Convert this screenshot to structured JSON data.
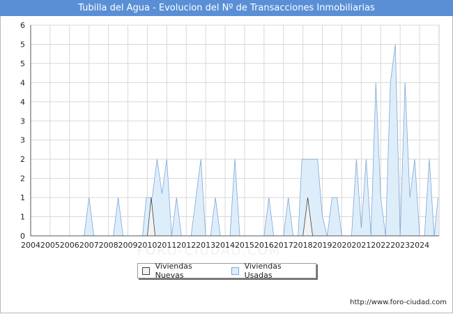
{
  "title": "Tubilla del Agua - Evolucion del Nº de Transacciones Inmobiliarias",
  "source": "http://www.foro-ciudad.com",
  "watermark": "FORO-CIUDAD.COM",
  "legend": {
    "nuevas": "Viviendas Nuevas",
    "usadas": "Viviendas Usadas"
  },
  "colors": {
    "title_bg": "#5a8fd6",
    "usadas_fill": "#ddeefa",
    "usadas_line": "#7fa6d8",
    "nuevas_fill": "#f2f2f2",
    "nuevas_line": "#404040",
    "grid": "#d8d8d8"
  },
  "chart_data": {
    "type": "area",
    "x_ticks": [
      "2004",
      "2005",
      "2006",
      "2007",
      "2008",
      "2009",
      "2010",
      "2011",
      "2012",
      "2013",
      "2014",
      "2015",
      "2016",
      "2017",
      "2018",
      "2019",
      "2020",
      "2021",
      "2022",
      "2023",
      "2024"
    ],
    "y_ticks": [
      "0",
      "1",
      "1",
      "2",
      "2",
      "3",
      "3",
      "4",
      "4",
      "5",
      "5",
      "6"
    ],
    "ylim": [
      0,
      5.5
    ],
    "grid": true,
    "legend_position": "bottom-center",
    "series": [
      {
        "name": "Viviendas Usadas",
        "points": [
          [
            2004.0,
            0
          ],
          [
            2006.75,
            0
          ],
          [
            2007.0,
            1
          ],
          [
            2007.25,
            0
          ],
          [
            2008.25,
            0
          ],
          [
            2008.5,
            1
          ],
          [
            2008.75,
            0
          ],
          [
            2009.75,
            0
          ],
          [
            2009.95,
            1
          ],
          [
            2010.25,
            1
          ],
          [
            2010.5,
            2
          ],
          [
            2010.75,
            1.1
          ],
          [
            2011.0,
            2
          ],
          [
            2011.25,
            0
          ],
          [
            2011.25,
            0
          ],
          [
            2011.5,
            1
          ],
          [
            2011.75,
            0
          ],
          [
            2012.25,
            0
          ],
          [
            2012.5,
            1
          ],
          [
            2012.75,
            2
          ],
          [
            2013.0,
            0
          ],
          [
            2013.25,
            0
          ],
          [
            2013.5,
            1
          ],
          [
            2013.75,
            0
          ],
          [
            2014.25,
            0
          ],
          [
            2014.5,
            2
          ],
          [
            2014.75,
            0
          ],
          [
            2016.0,
            0
          ],
          [
            2016.25,
            1
          ],
          [
            2016.5,
            0
          ],
          [
            2017.0,
            0
          ],
          [
            2017.25,
            1
          ],
          [
            2017.5,
            0
          ],
          [
            2017.75,
            0
          ],
          [
            2017.95,
            2
          ],
          [
            2018.75,
            2
          ],
          [
            2019.0,
            0.5
          ],
          [
            2019.25,
            0
          ],
          [
            2019.25,
            0
          ],
          [
            2019.5,
            1
          ],
          [
            2019.75,
            1
          ],
          [
            2020.0,
            0
          ],
          [
            2020.5,
            0
          ],
          [
            2020.75,
            2
          ],
          [
            2021.0,
            0.2
          ],
          [
            2021.25,
            2
          ],
          [
            2021.5,
            0
          ],
          [
            2021.5,
            0
          ],
          [
            2021.75,
            4
          ],
          [
            2022.0,
            1
          ],
          [
            2022.25,
            0
          ],
          [
            2022.25,
            0
          ],
          [
            2022.5,
            4
          ],
          [
            2022.75,
            5
          ],
          [
            2023.0,
            0
          ],
          [
            2023.0,
            0
          ],
          [
            2023.25,
            4
          ],
          [
            2023.5,
            1
          ],
          [
            2023.75,
            2
          ],
          [
            2024.0,
            0
          ],
          [
            2024.25,
            0
          ],
          [
            2024.5,
            2
          ],
          [
            2024.75,
            0
          ],
          [
            2024.95,
            1
          ]
        ]
      },
      {
        "name": "Viviendas Nuevas",
        "points": [
          [
            2004.0,
            0
          ],
          [
            2010.0,
            0
          ],
          [
            2010.2,
            1
          ],
          [
            2010.4,
            0
          ],
          [
            2018.0,
            0
          ],
          [
            2018.25,
            1
          ],
          [
            2018.5,
            0
          ],
          [
            2024.95,
            0
          ]
        ]
      }
    ]
  }
}
